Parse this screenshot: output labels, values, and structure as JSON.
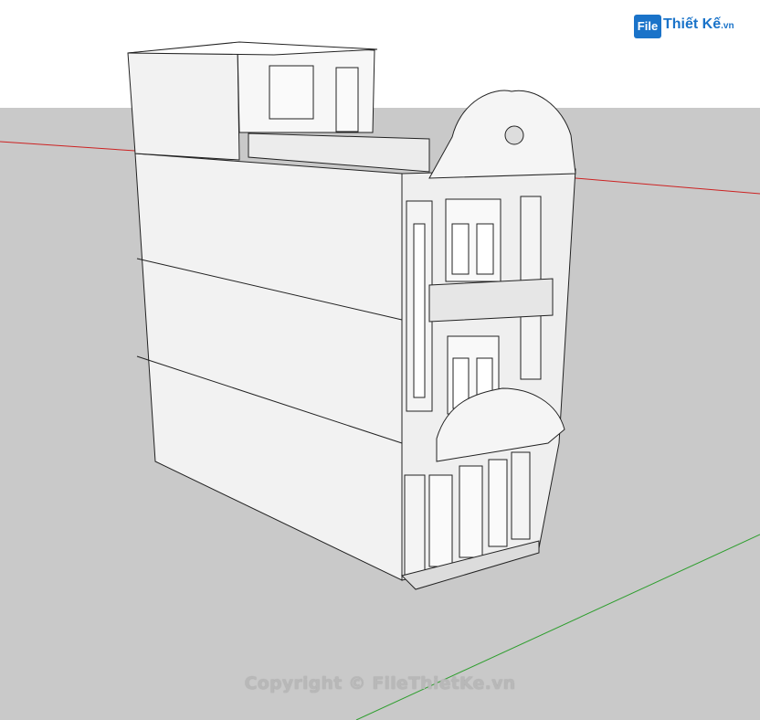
{
  "logo": {
    "badge": "File",
    "name": "Thiết Kế",
    "tld": ".vn"
  },
  "watermark": "Copyright © FileThietKe.vn",
  "colors": {
    "sky": "#ffffff",
    "ground": "#c9c9c9",
    "red_axis": "#cc2222",
    "green_axis": "#2e9e2e",
    "wall": "#f2f2f2",
    "line": "#222222"
  }
}
